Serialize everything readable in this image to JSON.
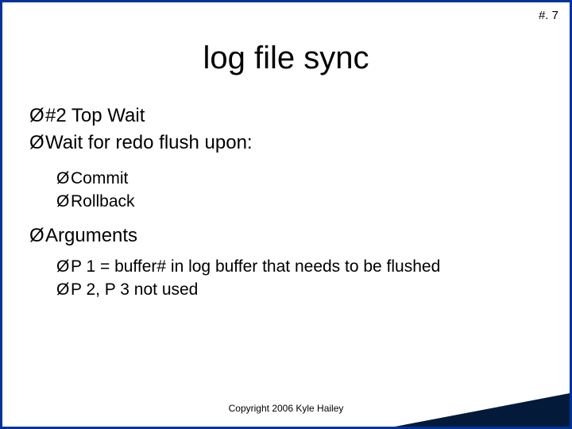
{
  "page_number": "#. 7",
  "title": "log file sync",
  "bullets": {
    "b1": "#2 Top Wait",
    "b2": "Wait for redo flush upon:",
    "b2a": "Commit",
    "b2b": "Rollback",
    "b3": "Arguments",
    "b3a": "P 1 = buffer# in log buffer that needs to be flushed",
    "b3b": "P 2, P 3 not used"
  },
  "footer": "Copyright 2006 Kyle Hailey",
  "glyph": "Ø"
}
